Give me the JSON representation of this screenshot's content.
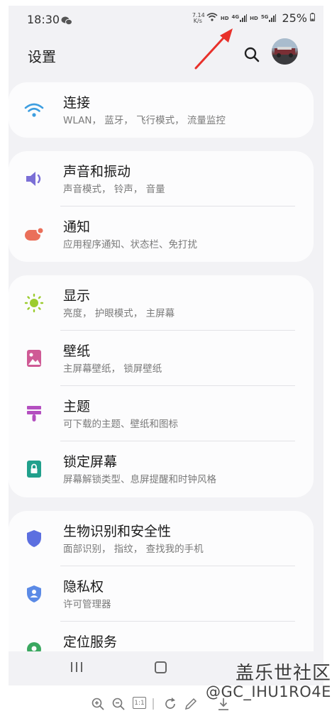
{
  "status_bar": {
    "time": "18:30",
    "net_speed_top": "7.14",
    "net_speed_bottom": "K/s",
    "hd1": "HD",
    "net1": "4G",
    "hd2": "HD",
    "net2": "5G",
    "battery": "25%"
  },
  "header": {
    "title": "设置"
  },
  "groups": [
    {
      "items": [
        {
          "title": "连接",
          "subtitle": "WLAN， 蓝牙， 飞行模式， 流量监控",
          "icon": "wifi-icon",
          "color": "#3d9ee0"
        }
      ]
    },
    {
      "items": [
        {
          "title": "声音和振动",
          "subtitle": "声音模式， 铃声， 音量",
          "icon": "volume-icon",
          "color": "#7b6fd6"
        },
        {
          "title": "通知",
          "subtitle": "应用程序通知、状态栏、免打扰",
          "icon": "notification-icon",
          "color": "#ea6f5a"
        }
      ]
    },
    {
      "items": [
        {
          "title": "显示",
          "subtitle": "亮度， 护眼模式， 主屏幕",
          "icon": "brightness-icon",
          "color": "#9ccc2f"
        },
        {
          "title": "壁纸",
          "subtitle": "主屏幕壁纸， 锁屏壁纸",
          "icon": "wallpaper-icon",
          "color": "#cf5a95"
        },
        {
          "title": "主题",
          "subtitle": "可下载的主题、壁纸和图标",
          "icon": "theme-icon",
          "color": "#b44fc0"
        },
        {
          "title": "锁定屏幕",
          "subtitle": "屏幕解锁类型、息屏提醒和时钟风格",
          "icon": "lock-icon",
          "color": "#21a08c"
        }
      ]
    },
    {
      "items": [
        {
          "title": "生物识别和安全性",
          "subtitle": "面部识别， 指纹， 查找我的手机",
          "icon": "shield-icon",
          "color": "#5c6fe0"
        },
        {
          "title": "隐私权",
          "subtitle": "许可管理器",
          "icon": "privacy-icon",
          "color": "#5b8ae6"
        },
        {
          "title": "定位服务",
          "subtitle": "",
          "icon": "location-icon",
          "color": "#3aa860"
        }
      ]
    }
  ],
  "watermark": {
    "site": "盖乐世社区",
    "user": "@GC_IHU1RO4E"
  },
  "viewer_toolbar": {
    "actual_size": "1:1"
  }
}
